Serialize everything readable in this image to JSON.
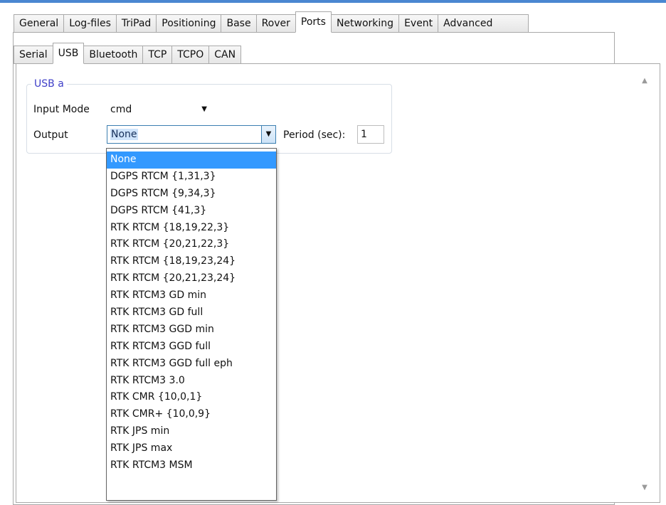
{
  "main_tabs": [
    "General",
    "Log-files",
    "TriPad",
    "Positioning",
    "Base",
    "Rover",
    "Ports",
    "Networking",
    "Event",
    "Advanced"
  ],
  "main_active_tab": "Ports",
  "sub_tabs": [
    "Serial",
    "USB",
    "Bluetooth",
    "TCP",
    "TCPO",
    "CAN"
  ],
  "sub_active_tab": "USB",
  "group": {
    "title": "USB a",
    "input_mode_label": "Input Mode",
    "input_mode_value": "cmd",
    "output_label": "Output",
    "output_value": "None",
    "period_label": "Period (sec):",
    "period_value": "1"
  },
  "output_options": [
    "None",
    "DGPS RTCM {1,31,3}",
    "DGPS RTCM {9,34,3}",
    "DGPS RTCM {41,3}",
    "RTK RTCM {18,19,22,3}",
    "RTK RTCM {20,21,22,3}",
    "RTK RTCM {18,19,23,24}",
    "RTK RTCM {20,21,23,24}",
    "RTK RTCM3 GD min",
    "RTK RTCM3 GD full",
    "RTK RTCM3 GGD min",
    "RTK RTCM3 GGD full",
    "RTK RTCM3 GGD full eph",
    "RTK RTCM3 3.0",
    "RTK CMR {10,0,1}",
    "RTK CMR+ {10,0,9}",
    "RTK JPS min",
    "RTK JPS max",
    "RTK RTCM3 MSM"
  ],
  "output_selected_index": 0,
  "icons": {
    "scroll_up": "scroll-up-icon",
    "scroll_down": "scroll-down-icon",
    "dropdown": "chevron-down-icon"
  },
  "colors": {
    "accent": "#4a87d1",
    "selection": "#3399ff",
    "group_title": "#3e3ec8"
  }
}
